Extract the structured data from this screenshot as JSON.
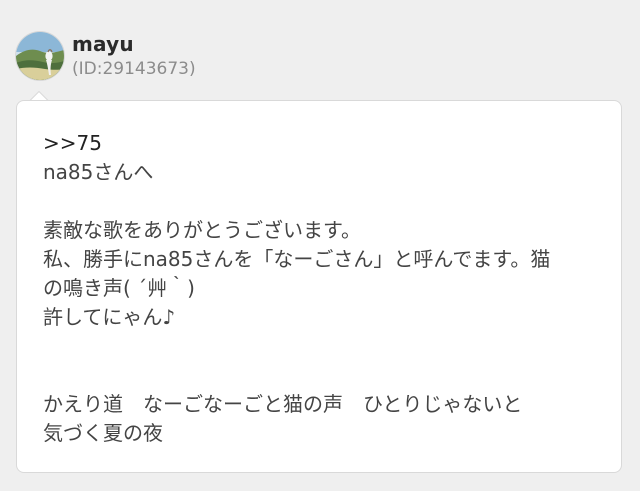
{
  "post": {
    "username": "mayu",
    "user_id": "(ID:29143673)",
    "avatar_icon": "user-avatar-icon",
    "lines": [
      ">>75",
      "na85さんへ",
      "素敵な歌をありがとうございます。",
      "私、勝手にna85さんを「なーごさん」と呼んでます。猫",
      "の鳴き声( ´艸｀)",
      "許してにゃん♪",
      "かえり道　なーごなーごと猫の声　ひとりじゃないと",
      "気づく夏の夜"
    ]
  },
  "colors": {
    "background": "#efefef",
    "card": "#ffffff",
    "border": "#d9d9d9",
    "text": "#444444",
    "muted": "#8c8c8c"
  }
}
